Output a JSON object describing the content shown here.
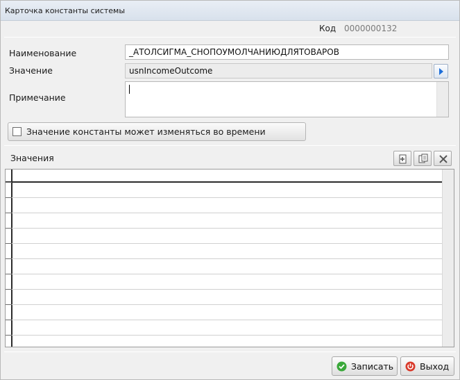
{
  "window": {
    "title": "Карточка константы системы"
  },
  "code": {
    "label": "Код",
    "value": "0000000132"
  },
  "form": {
    "name_label": "Наименование",
    "name_value": "_АТОЛСИГМА_СНОПОУМОЛЧАНИЮДЛЯТОВАРОВ",
    "value_label": "Значение",
    "value_value": "usnIncomeOutcome",
    "note_label": "Примечание",
    "note_value": "",
    "time_checkbox_label": "Значение константы может изменяться во времени",
    "time_checkbox_checked": false
  },
  "values_section": {
    "title": "Значения",
    "rows": []
  },
  "toolbar": {
    "add_icon": "add-row-icon",
    "copy_icon": "copy-row-icon",
    "delete_icon": "delete-row-icon"
  },
  "buttons": {
    "save_label": "Записать",
    "exit_label": "Выход"
  },
  "colors": {
    "save_icon": "#3aa83a",
    "exit_icon": "#d93a2b",
    "pick_arrow": "#1e6fd9"
  }
}
